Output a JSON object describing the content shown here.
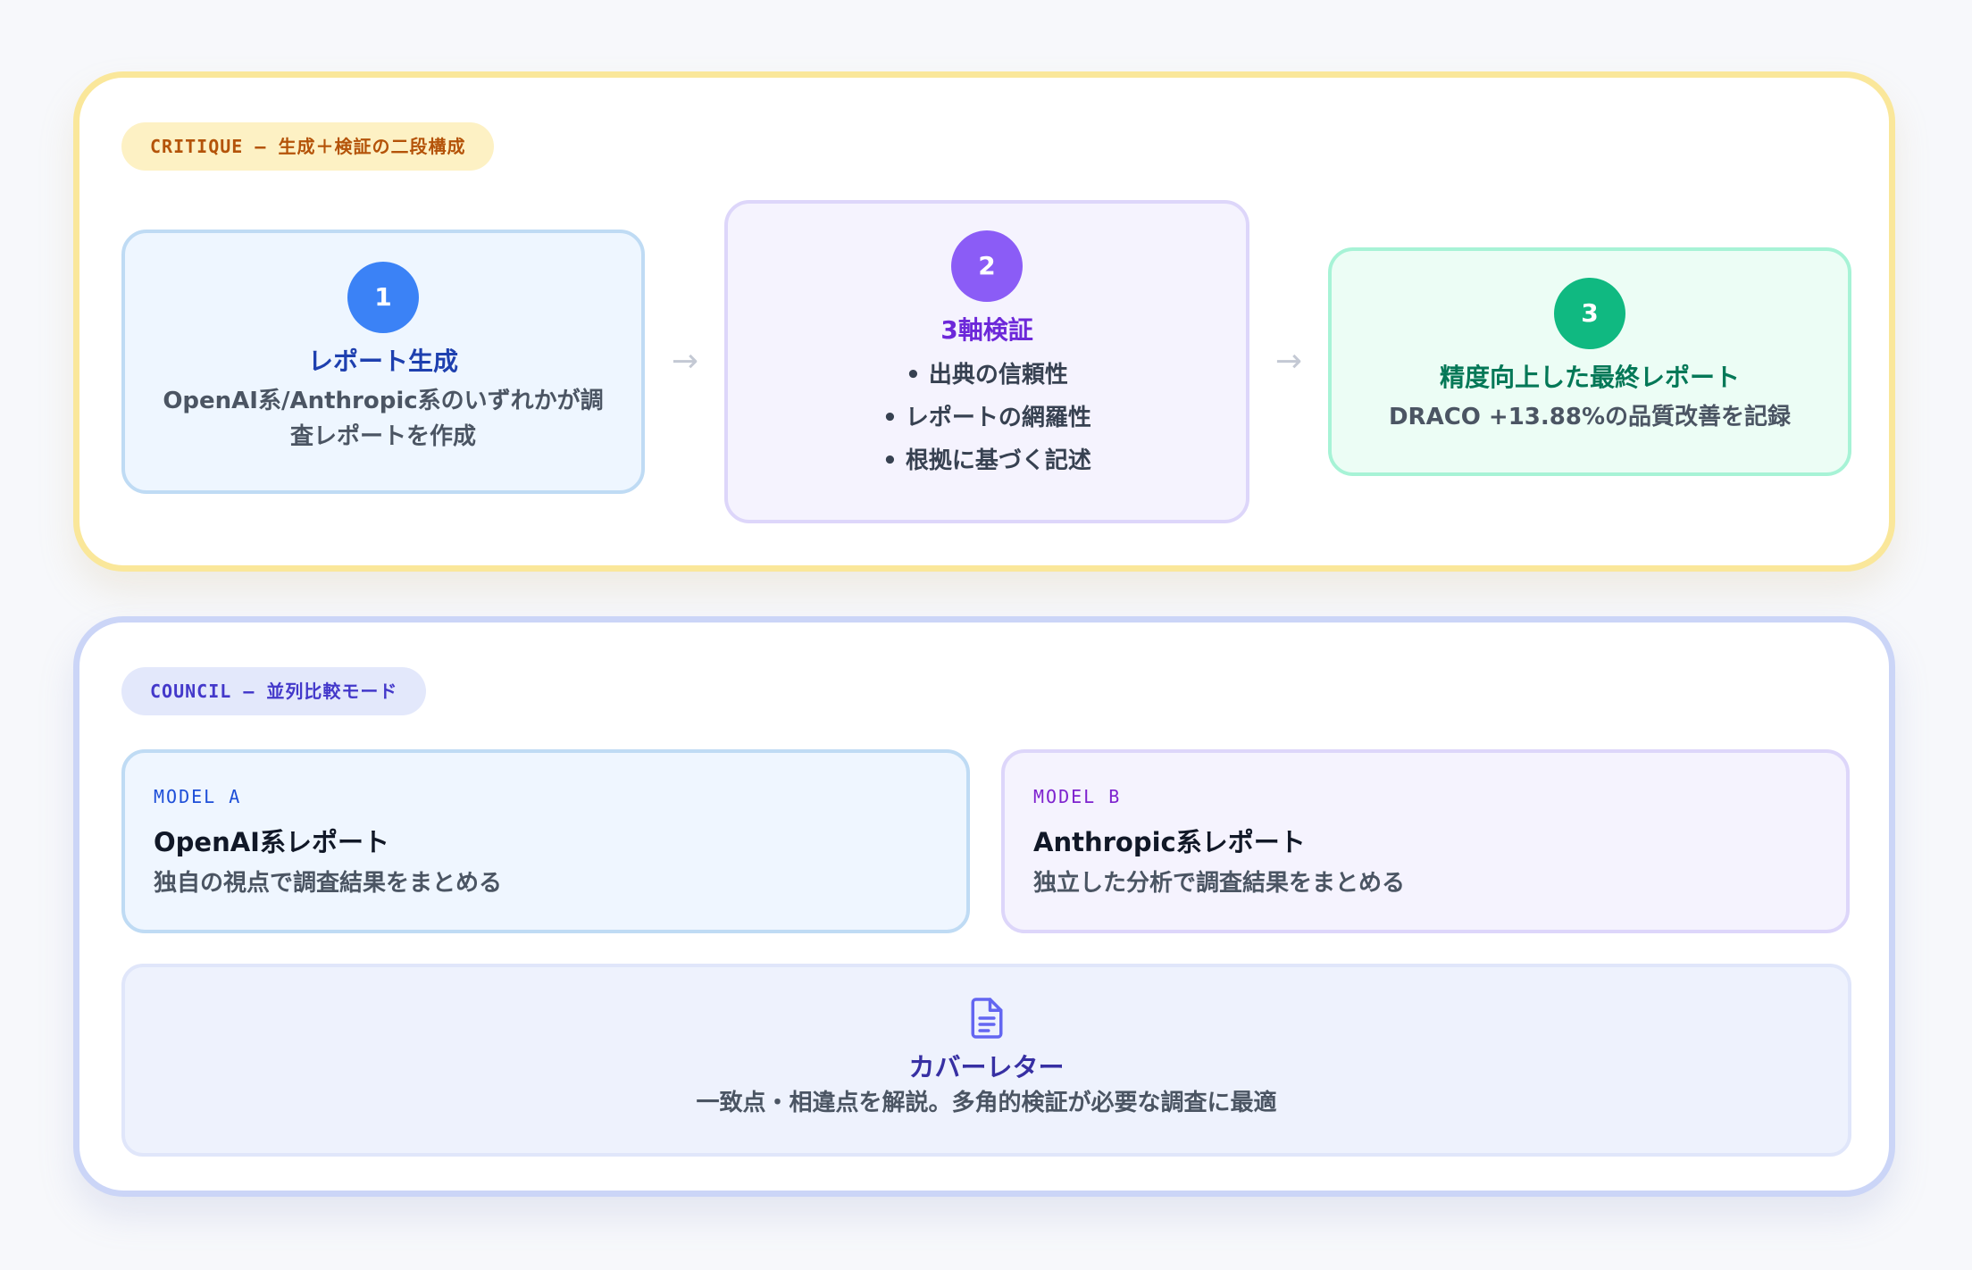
{
  "critique": {
    "label": "CRITIQUE — 生成＋検証の二段構成",
    "steps": [
      {
        "number": "1",
        "title": "レポート生成",
        "desc": "OpenAI系/Anthropic系のいずれかが調査レポートを作成"
      },
      {
        "number": "2",
        "title": "3軸検証",
        "bullets": [
          "出典の信頼性",
          "レポートの網羅性",
          "根拠に基づく記述"
        ]
      },
      {
        "number": "3",
        "title": "精度向上した最終レポート",
        "desc": "DRACO +13.88%の品質改善を記録"
      }
    ],
    "arrow": "→"
  },
  "council": {
    "label": "COUNCIL — 並列比較モード",
    "models": [
      {
        "tag": "MODEL A",
        "title": "OpenAI系レポート",
        "desc": "独自の視点で調査結果をまとめる"
      },
      {
        "tag": "MODEL B",
        "title": "Anthropic系レポート",
        "desc": "独立した分析で調査結果をまとめる"
      }
    ],
    "cover": {
      "icon": "document-icon",
      "title": "カバーレター",
      "desc": "一致点・相違点を解説。多角的検証が必要な調査に最適"
    }
  },
  "colors": {
    "critique_border": "#fae79a",
    "council_border": "#cbd5f7",
    "step1": "#3b82f6",
    "step2": "#8b5cf6",
    "step3": "#10b981"
  }
}
